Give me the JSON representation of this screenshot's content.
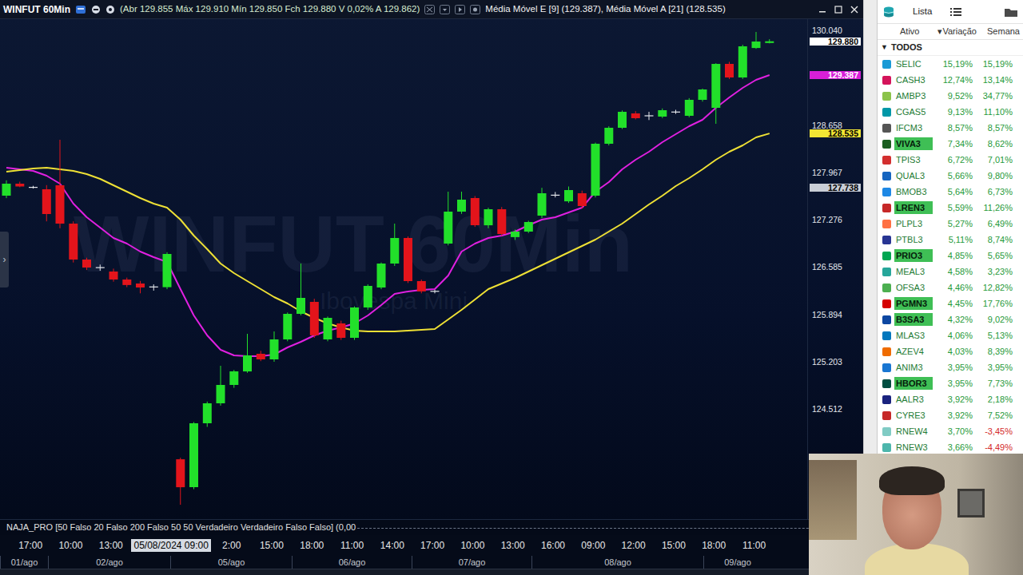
{
  "window": {
    "title": "WINFUT 60Min",
    "quote": "(Abr 129.855 Máx 129.910 Mín 129.850 Fch 129.880 V 0,02% A 129.862)",
    "studies": "Média Móvel E [9] (129.387), Média Móvel A [21] (128.535)"
  },
  "chart": {
    "watermark": "WINFUT 60Min",
    "watermark_sub": "Ibovespa Mini",
    "side_toggle": "›",
    "candles": [
      [
        127626,
        127850,
        127590,
        127801
      ],
      [
        127801,
        127830,
        127750,
        127760
      ],
      [
        127750,
        127770,
        127730,
        127745
      ],
      [
        127719,
        127780,
        127250,
        127358
      ],
      [
        127778,
        128442,
        127150,
        127218
      ],
      [
        127218,
        127250,
        126650,
        126693
      ],
      [
        126693,
        126720,
        126540,
        126576
      ],
      [
        126580,
        126620,
        126530,
        126570
      ],
      [
        126518,
        126560,
        126370,
        126401
      ],
      [
        126401,
        126430,
        126290,
        126320
      ],
      [
        126343,
        126380,
        126200,
        126285
      ],
      [
        126285,
        126330,
        126240,
        126300
      ],
      [
        126290,
        126800,
        126260,
        126775
      ],
      [
        123777,
        123800,
        123113,
        123369
      ],
      [
        123369,
        124320,
        123340,
        124302
      ],
      [
        124302,
        124620,
        124250,
        124594
      ],
      [
        124594,
        125142,
        124560,
        124862
      ],
      [
        124862,
        125080,
        124820,
        125060
      ],
      [
        125060,
        125609,
        125040,
        125294
      ],
      [
        125317,
        125360,
        125210,
        125235
      ],
      [
        125235,
        125644,
        125200,
        125527
      ],
      [
        125527,
        125920,
        125500,
        125900
      ],
      [
        125900,
        126635,
        125880,
        126133
      ],
      [
        126075,
        126120,
        125550,
        125586
      ],
      [
        125527,
        125860,
        125500,
        125842
      ],
      [
        125760,
        125800,
        125520,
        125550
      ],
      [
        125550,
        126010,
        125520,
        125993
      ],
      [
        125993,
        126330,
        125960,
        126308
      ],
      [
        126285,
        126650,
        126260,
        126635
      ],
      [
        126635,
        127218,
        126600,
        127008
      ],
      [
        127008,
        127030,
        126350,
        126378
      ],
      [
        126378,
        126400,
        126200,
        126227
      ],
      [
        126227,
        126250,
        126200,
        126230
      ],
      [
        126926,
        127684,
        126900,
        127393
      ],
      [
        127393,
        127684,
        127360,
        127568
      ],
      [
        127591,
        127620,
        127170,
        127194
      ],
      [
        127194,
        127450,
        127150,
        127428
      ],
      [
        127428,
        127460,
        127040,
        127066
      ],
      [
        127020,
        127130,
        126980,
        127101
      ],
      [
        127101,
        127260,
        127080,
        127241
      ],
      [
        127334,
        127740,
        127300,
        127661
      ],
      [
        127640,
        127680,
        127600,
        127626
      ],
      [
        127544,
        127760,
        127520,
        127708
      ],
      [
        127661,
        127700,
        127440,
        127474
      ],
      [
        127626,
        128400,
        127600,
        128384
      ],
      [
        128384,
        128640,
        128360,
        128617
      ],
      [
        128617,
        128870,
        128600,
        128850
      ],
      [
        128827,
        128860,
        128740,
        128757
      ],
      [
        128790,
        128850,
        128730,
        128795
      ],
      [
        128781,
        128900,
        128760,
        128874
      ],
      [
        128850,
        128880,
        128820,
        128845
      ],
      [
        128792,
        129050,
        128770,
        129025
      ],
      [
        129025,
        129190,
        129000,
        129177
      ],
      [
        128909,
        129560,
        128676,
        129550
      ],
      [
        129550,
        129580,
        129330,
        129352
      ],
      [
        129352,
        129830,
        129330,
        129807
      ],
      [
        129783,
        130017,
        129770,
        129877
      ],
      [
        129855,
        129910,
        129850,
        129880
      ]
    ],
    "series": [
      {
        "name": "Média Móvel E [9]",
        "color": "#e020e0",
        "values": [
          128034,
          128011,
          127987,
          127918,
          127801,
          127509,
          127311,
          127160,
          127008,
          126926,
          126810,
          126728,
          126658,
          126261,
          125877,
          125585,
          125375,
          125294,
          125282,
          125282,
          125305,
          125410,
          125492,
          125585,
          125655,
          125702,
          125760,
          125877,
          126028,
          126192,
          126227,
          126250,
          126261,
          126460,
          126810,
          126926,
          127008,
          127043,
          127101,
          127195,
          127276,
          127311,
          127381,
          127451,
          127684,
          127824,
          128011,
          128151,
          128267,
          128407,
          128524,
          128641,
          128734,
          128909,
          129060,
          129200,
          129317,
          129387
        ]
      },
      {
        "name": "Média Móvel A [21]",
        "color": "#eee035",
        "values": [
          127976,
          127999,
          128022,
          128034,
          128011,
          127987,
          127941,
          127871,
          127778,
          127684,
          127591,
          127509,
          127451,
          127276,
          127043,
          126845,
          126635,
          126495,
          126378,
          126261,
          126145,
          126052,
          125935,
          125842,
          125760,
          125702,
          125655,
          125643,
          125643,
          125643,
          125655,
          125667,
          125678,
          125818,
          125958,
          126110,
          126261,
          126343,
          126425,
          126518,
          126611,
          126705,
          126798,
          126891,
          126985,
          127101,
          127218,
          127358,
          127498,
          127626,
          127766,
          127883,
          128011,
          128151,
          128267,
          128361,
          128477,
          128535
        ]
      }
    ],
    "price_ticks": [
      {
        "label": "130.040",
        "value": 130040
      },
      {
        "label": "128.658",
        "value": 128658
      },
      {
        "label": "127.967",
        "value": 127967
      },
      {
        "label": "127.276",
        "value": 127276
      },
      {
        "label": "126.585",
        "value": 126585
      },
      {
        "label": "125.894",
        "value": 125894
      },
      {
        "label": "125.203",
        "value": 125203
      },
      {
        "label": "124.512",
        "value": 124512
      }
    ],
    "price_markers": [
      {
        "label": "129.880",
        "value": 129880,
        "color": "#ffffff"
      },
      {
        "label": "129.387",
        "value": 129387,
        "color": "#d81fd8"
      },
      {
        "label": "128.535",
        "value": 128535,
        "color": "#f2e534"
      },
      {
        "label": "127.738",
        "value": 127738,
        "color": "#c9ced6"
      }
    ],
    "time_ticks": [
      {
        "label": "17:00",
        "highlighted": false
      },
      {
        "label": "10:00",
        "highlighted": false
      },
      {
        "label": "13:00",
        "highlighted": false
      },
      {
        "label": "05/08/2024 09:00",
        "highlighted": true
      },
      {
        "label": "2:00",
        "highlighted": false
      },
      {
        "label": "15:00",
        "highlighted": false
      },
      {
        "label": "18:00",
        "highlighted": false
      },
      {
        "label": "11:00",
        "highlighted": false
      },
      {
        "label": "14:00",
        "highlighted": false
      },
      {
        "label": "17:00",
        "highlighted": false
      },
      {
        "label": "10:00",
        "highlighted": false
      },
      {
        "label": "13:00",
        "highlighted": false
      },
      {
        "label": "16:00",
        "highlighted": false
      },
      {
        "label": "09:00",
        "highlighted": false
      },
      {
        "label": "12:00",
        "highlighted": false
      },
      {
        "label": "15:00",
        "highlighted": false
      },
      {
        "label": "18:00",
        "highlighted": false
      },
      {
        "label": "11:00",
        "highlighted": false
      }
    ],
    "dates": [
      "01/ago",
      "02/ago",
      "05/ago",
      "06/ago",
      "07/ago",
      "08/ago",
      "09/ago"
    ],
    "indicator": "NAJA_PRO [50 Falso 20 Falso 200 Falso 50 50 Verdadeiro Verdadeiro Falso Falso] (0,00"
  },
  "watchlist": {
    "title": "Lista",
    "sort_arrow": "▾",
    "columns": [
      {
        "label": "Ativo",
        "sorted": false
      },
      {
        "label": "Variação",
        "sorted": true
      },
      {
        "label": "Semana",
        "sorted": false
      }
    ],
    "group": {
      "label": "TODOS",
      "toggle": "▼",
      "expanded": true
    },
    "rows": [
      {
        "ticker": "SELIC",
        "change": "15,19%",
        "week": "15,19%",
        "week_negative": false,
        "highlighted": false,
        "color": "#1a9ad6"
      },
      {
        "ticker": "CASH3",
        "change": "12,74%",
        "week": "13,14%",
        "week_negative": false,
        "highlighted": false,
        "color": "#d4145a"
      },
      {
        "ticker": "AMBP3",
        "change": "9,52%",
        "week": "34,77%",
        "week_negative": false,
        "highlighted": false,
        "color": "#8bc34a"
      },
      {
        "ticker": "CGAS5",
        "change": "9,13%",
        "week": "11,10%",
        "week_negative": false,
        "highlighted": false,
        "color": "#0097a7"
      },
      {
        "ticker": "IFCM3",
        "change": "8,57%",
        "week": "8,57%",
        "week_negative": false,
        "highlighted": false,
        "color": "#555555"
      },
      {
        "ticker": "VIVA3",
        "change": "7,34%",
        "week": "8,62%",
        "week_negative": false,
        "highlighted": true,
        "color": "#1b5e20"
      },
      {
        "ticker": "TPIS3",
        "change": "6,72%",
        "week": "7,01%",
        "week_negative": false,
        "highlighted": false,
        "color": "#d32f2f"
      },
      {
        "ticker": "QUAL3",
        "change": "5,66%",
        "week": "9,80%",
        "week_negative": false,
        "highlighted": false,
        "color": "#1565c0"
      },
      {
        "ticker": "BMOB3",
        "change": "5,64%",
        "week": "6,73%",
        "week_negative": false,
        "highlighted": false,
        "color": "#1e88e5"
      },
      {
        "ticker": "LREN3",
        "change": "5,59%",
        "week": "11,26%",
        "week_negative": false,
        "highlighted": true,
        "color": "#c62828"
      },
      {
        "ticker": "PLPL3",
        "change": "5,27%",
        "week": "6,49%",
        "week_negative": false,
        "highlighted": false,
        "color": "#ff7043"
      },
      {
        "ticker": "PTBL3",
        "change": "5,11%",
        "week": "8,74%",
        "week_negative": false,
        "highlighted": false,
        "color": "#283593"
      },
      {
        "ticker": "PRIO3",
        "change": "4,85%",
        "week": "5,65%",
        "week_negative": false,
        "highlighted": true,
        "color": "#00a651"
      },
      {
        "ticker": "MEAL3",
        "change": "4,58%",
        "week": "3,23%",
        "week_negative": false,
        "highlighted": false,
        "color": "#26a69a"
      },
      {
        "ticker": "OFSA3",
        "change": "4,46%",
        "week": "12,82%",
        "week_negative": false,
        "highlighted": false,
        "color": "#4caf50"
      },
      {
        "ticker": "PGMN3",
        "change": "4,45%",
        "week": "17,76%",
        "week_negative": false,
        "highlighted": true,
        "color": "#d50000"
      },
      {
        "ticker": "B3SA3",
        "change": "4,32%",
        "week": "9,02%",
        "week_negative": false,
        "highlighted": true,
        "color": "#0d47a1"
      },
      {
        "ticker": "MLAS3",
        "change": "4,06%",
        "week": "5,13%",
        "week_negative": false,
        "highlighted": false,
        "color": "#0277bd"
      },
      {
        "ticker": "AZEV4",
        "change": "4,03%",
        "week": "8,39%",
        "week_negative": false,
        "highlighted": false,
        "color": "#ef6c00"
      },
      {
        "ticker": "ANIM3",
        "change": "3,95%",
        "week": "3,95%",
        "week_negative": false,
        "highlighted": false,
        "color": "#1976d2"
      },
      {
        "ticker": "HBOR3",
        "change": "3,95%",
        "week": "7,73%",
        "week_negative": false,
        "highlighted": true,
        "color": "#004d40"
      },
      {
        "ticker": "AALR3",
        "change": "3,92%",
        "week": "2,18%",
        "week_negative": false,
        "highlighted": false,
        "color": "#1a237e"
      },
      {
        "ticker": "CYRE3",
        "change": "3,92%",
        "week": "7,52%",
        "week_negative": false,
        "highlighted": false,
        "color": "#c62828"
      },
      {
        "ticker": "RNEW4",
        "change": "3,70%",
        "week": "-3,45%",
        "week_negative": true,
        "highlighted": false,
        "color": "#80cbc4"
      },
      {
        "ticker": "RNEW3",
        "change": "3,66%",
        "week": "-4,49%",
        "week_negative": true,
        "highlighted": false,
        "color": "#4db6ac"
      }
    ]
  }
}
